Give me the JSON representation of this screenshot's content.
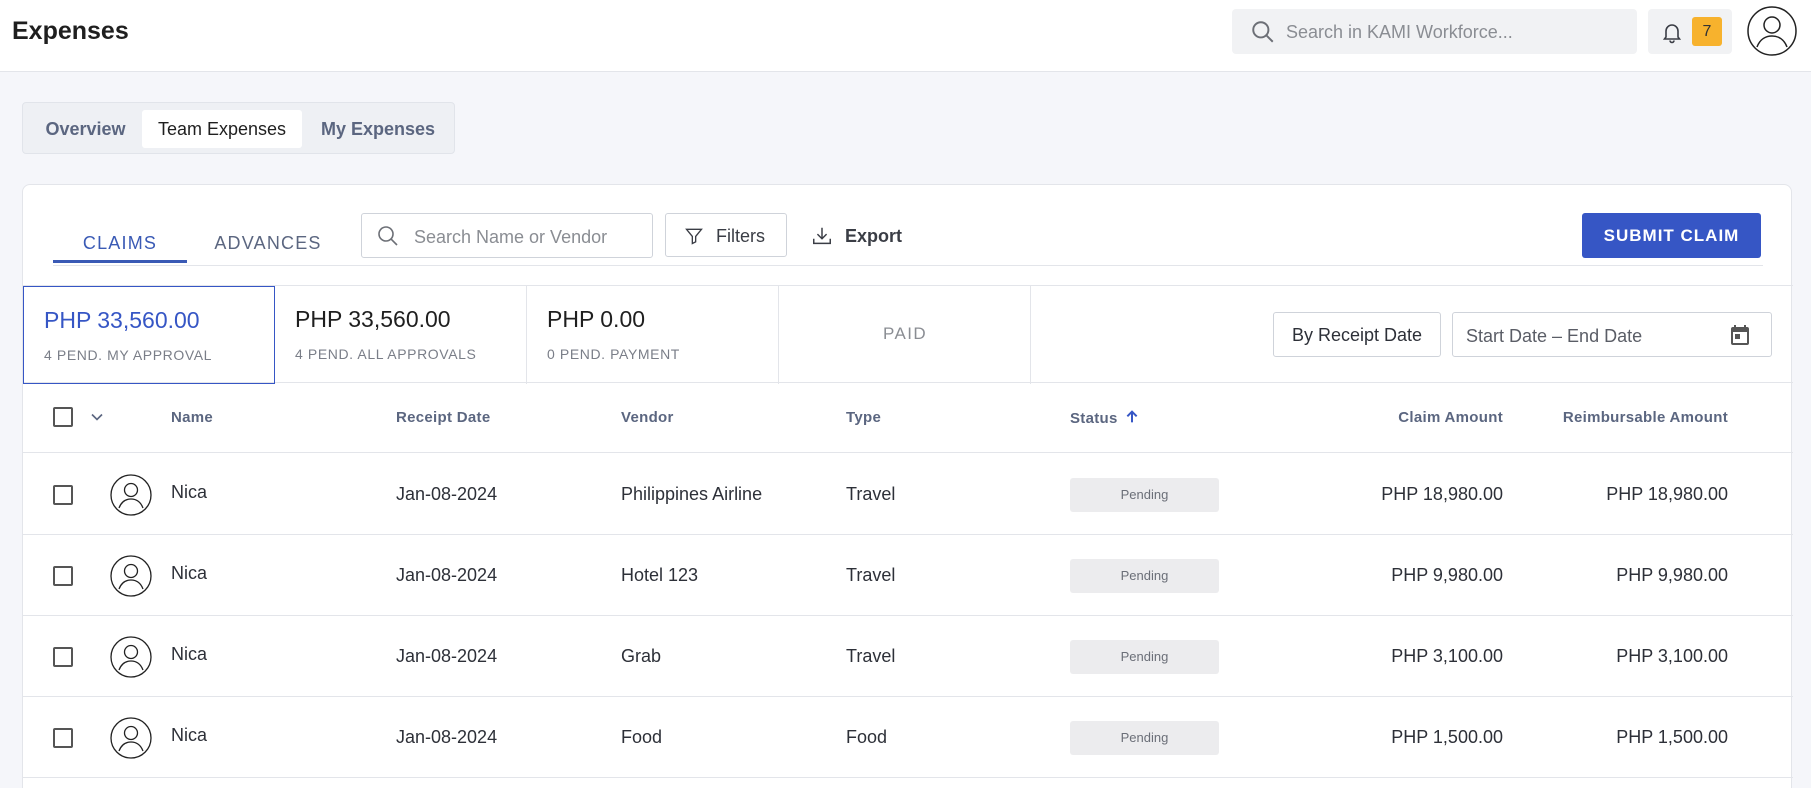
{
  "header": {
    "title": "Expenses",
    "search_placeholder": "Search in KAMI Workforce...",
    "notification_count": "7"
  },
  "view_tabs": [
    {
      "label": "Overview",
      "active": false
    },
    {
      "label": "Team Expenses",
      "active": true
    },
    {
      "label": "My Expenses",
      "active": false
    }
  ],
  "card": {
    "subtabs": [
      {
        "label": "CLAIMS",
        "active": true
      },
      {
        "label": "ADVANCES",
        "active": false
      }
    ],
    "search_placeholder": "Search Name or Vendor",
    "filters_label": "Filters",
    "export_label": "Export",
    "submit_label": "SUBMIT CLAIM"
  },
  "summary": [
    {
      "amount": "PHP 33,560.00",
      "label": "4  PEND. MY APPROVAL",
      "active": true
    },
    {
      "amount": "PHP 33,560.00",
      "label": "4  PEND. ALL APPROVALS",
      "active": false
    },
    {
      "amount": "PHP 0.00",
      "label": "0 PEND. PAYMENT",
      "active": false
    },
    {
      "amount": "",
      "label": "PAID",
      "active": false
    }
  ],
  "date_filter": {
    "by_label": "By Receipt Date",
    "range_placeholder": "Start Date – End Date"
  },
  "table": {
    "columns": {
      "name": "Name",
      "receipt_date": "Receipt Date",
      "vendor": "Vendor",
      "type": "Type",
      "status": "Status",
      "claim_amount": "Claim Amount",
      "reimbursable_amount": "Reimbursable Amount"
    },
    "sort": {
      "column": "Status",
      "direction": "ascending"
    },
    "rows": [
      {
        "name": "Nica",
        "receipt_date": "Jan-08-2024",
        "vendor": "Philippines Airline",
        "type": "Travel",
        "status": "Pending",
        "claim_amount": "PHP 18,980.00",
        "reimbursable_amount": "PHP 18,980.00"
      },
      {
        "name": "Nica",
        "receipt_date": "Jan-08-2024",
        "vendor": "Hotel 123",
        "type": "Travel",
        "status": "Pending",
        "claim_amount": "PHP 9,980.00",
        "reimbursable_amount": "PHP 9,980.00"
      },
      {
        "name": "Nica",
        "receipt_date": "Jan-08-2024",
        "vendor": "Grab",
        "type": "Travel",
        "status": "Pending",
        "claim_amount": "PHP 3,100.00",
        "reimbursable_amount": "PHP 3,100.00"
      },
      {
        "name": "Nica",
        "receipt_date": "Jan-08-2024",
        "vendor": "Food",
        "type": "Food",
        "status": "Pending",
        "claim_amount": "PHP 1,500.00",
        "reimbursable_amount": "PHP 1,500.00"
      }
    ]
  },
  "icons": {
    "search": "search-icon",
    "bell": "bell-icon",
    "avatar": "user-avatar-icon",
    "filter": "filter-icon",
    "export": "download-icon",
    "calendar": "calendar-icon",
    "sort": "arrow-up-icon",
    "chevron": "chevron-down-icon"
  },
  "colors": {
    "primary": "#3656c5",
    "badge": "#f7b22d",
    "pill_bg": "#ececee"
  }
}
